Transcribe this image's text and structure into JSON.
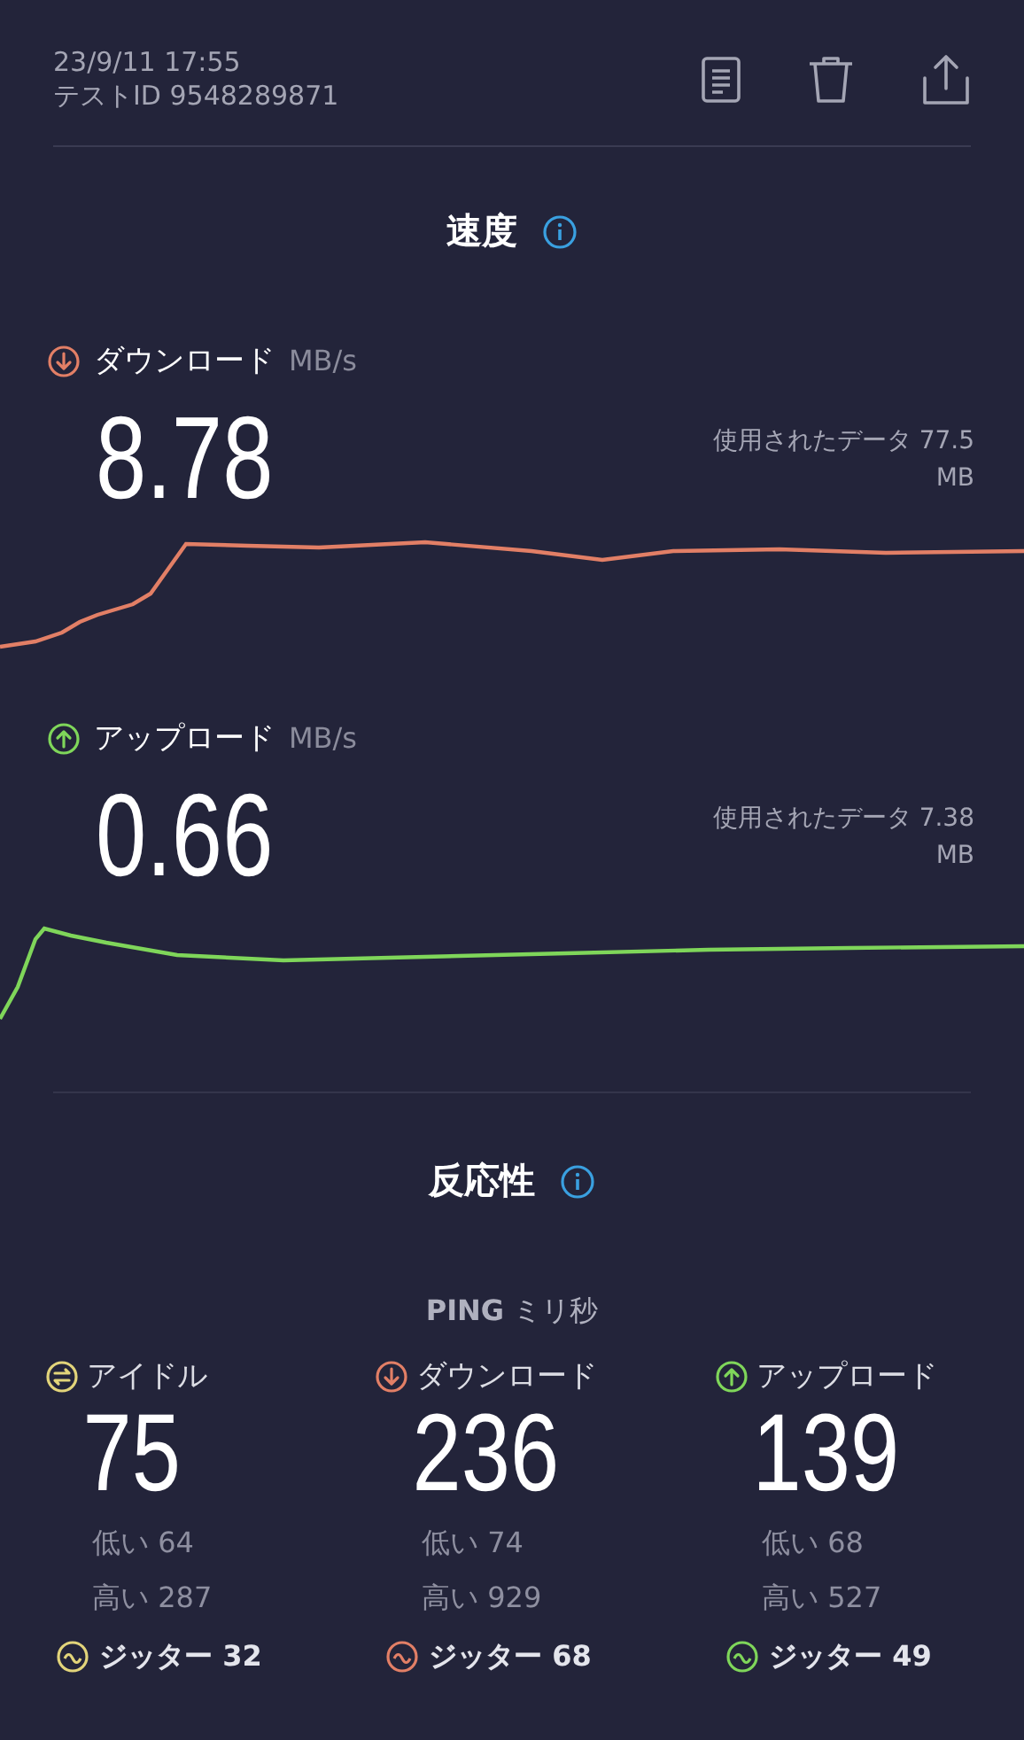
{
  "header": {
    "datetime": "23/9/11 17:55",
    "test_id": "テストID 9548289871"
  },
  "speed": {
    "title": "速度",
    "results": [
      {
        "kind": "download",
        "label": "ダウンロード",
        "unit": "MB/s",
        "value": "8.78",
        "data_used": "使用されたデータ 77.5 MB",
        "color": "#e27f66"
      },
      {
        "kind": "upload",
        "label": "アップロード",
        "unit": "MB/s",
        "value": "0.66",
        "data_used": "使用されたデータ 7.38 MB",
        "color": "#7fd65a"
      }
    ]
  },
  "responsiveness": {
    "title": "反応性",
    "ping_label": "PING",
    "ping_unit": "ミリ秒",
    "columns": [
      {
        "kind": "idle",
        "label": "アイドル",
        "value": "75",
        "low": "低い 64",
        "high": "高い 287",
        "jitter": "ジッター 32",
        "color": "#e2d47a"
      },
      {
        "kind": "download",
        "label": "ダウンロード",
        "value": "236",
        "low": "低い 74",
        "high": "高い 929",
        "jitter": "ジッター 68",
        "color": "#e27f66"
      },
      {
        "kind": "upload",
        "label": "アップロード",
        "value": "139",
        "low": "低い 68",
        "high": "高い 527",
        "jitter": "ジッター 49",
        "color": "#7fd65a"
      }
    ]
  }
}
